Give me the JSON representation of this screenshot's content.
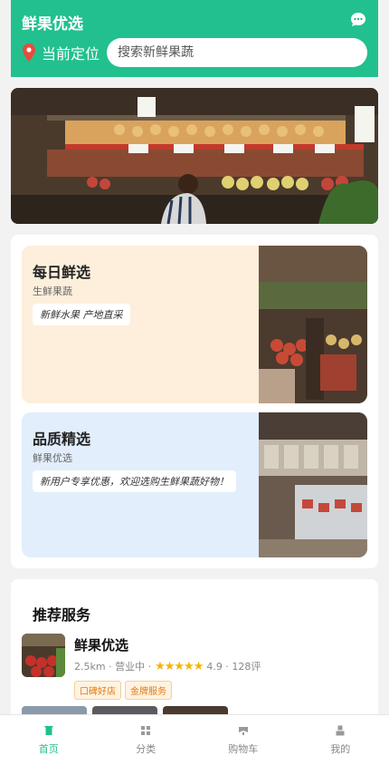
{
  "header": {
    "title": "鲜果优选",
    "location_label": "当前定位",
    "search_placeholder": "搜索新鲜果蔬",
    "chat_icon": "chat-bubble-icon",
    "location_icon": "location-pin-icon",
    "bg_color": "#22c08f"
  },
  "features": [
    {
      "title": "每日鲜选",
      "subtitle": "生鲜果蔬",
      "tag": "新鲜水果 产地直采",
      "bg_color": "#fdefdc"
    },
    {
      "title": "品质精选",
      "subtitle": "鲜果优选",
      "tag": "新用户专享优惠，欢迎选购生鲜果蔬好物！",
      "bg_color": "#e2eefc"
    }
  ],
  "services": {
    "title": "推荐服务",
    "store": {
      "name": "鲜果优选",
      "distance": "2.5km",
      "status": "营业中",
      "rating_stars": 5,
      "rating": "4.9",
      "reviews": "128评",
      "badges": [
        "口碑好店",
        "金牌服务"
      ]
    }
  },
  "tabbar": {
    "accent": "#22c08f",
    "items": [
      {
        "label": "首页",
        "icon": "home-icon",
        "active": true
      },
      {
        "label": "分类",
        "icon": "category-grid-icon",
        "active": false
      },
      {
        "label": "购物车",
        "icon": "cart-icon",
        "active": false
      },
      {
        "label": "我的",
        "icon": "user-icon",
        "active": false
      }
    ]
  }
}
